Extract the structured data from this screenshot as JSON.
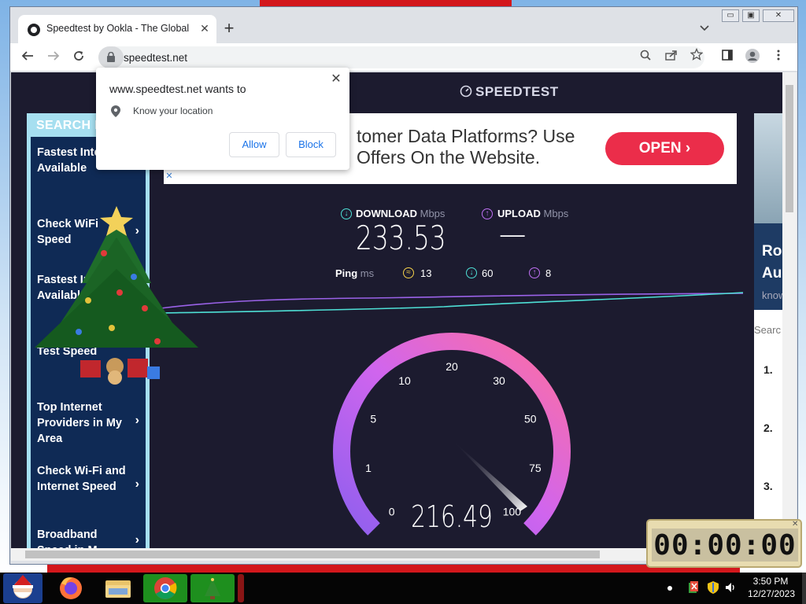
{
  "browser": {
    "tab_title": "Speedtest by Ookla - The Global",
    "tab_close": "✕",
    "new_tab": "+",
    "url": "speedtest.net",
    "window_buttons": [
      "▭",
      "▣",
      "✕"
    ]
  },
  "page": {
    "brand": "SPEEDTEST",
    "left_ad": {
      "header": "SEARCH F",
      "items": [
        "Fastest Internet Available",
        "Check WiFi Speed",
        "Fastest Internet Available",
        "Test Speed",
        "Top Internet Providers in My Area",
        "Check Wi-Fi and Internet Speed",
        "Broadband Speed in M"
      ],
      "chevron": "›"
    },
    "banner_ad": {
      "line1": "tomer Data Platforms? Use",
      "line2": "Offers On the Website.",
      "button": "OPEN",
      "close": "✕"
    },
    "right_ad": {
      "title_line1": "Ro",
      "title_line2": "Au",
      "know": "know",
      "search": "Searc",
      "numbers": [
        "1.",
        "2.",
        "3."
      ]
    },
    "results": {
      "download_label": "DOWNLOAD",
      "download_unit": "Mbps",
      "download_value": "233.53",
      "upload_label": "UPLOAD",
      "upload_unit": "Mbps",
      "upload_value": "—",
      "ping_label": "Ping",
      "ping_unit": "ms",
      "ping_idle": "13",
      "ping_download": "60",
      "ping_upload": "8"
    },
    "gauge": {
      "ticks": [
        "0",
        "1",
        "5",
        "10",
        "20",
        "30",
        "50",
        "75",
        "100"
      ],
      "current_value": "216.49",
      "fill_fraction": 1.0,
      "colors": {
        "start": "#9b6cf2",
        "end": "#ff6fa0",
        "track": "#25243a"
      }
    }
  },
  "permission_popup": {
    "title": "www.speedtest.net wants to",
    "permission": "Know your location",
    "allow": "Allow",
    "block": "Block",
    "close": "✕"
  },
  "clock_widget": {
    "time": "00:00:00"
  },
  "taskbar": {
    "time": "3:50 PM",
    "date": "12/27/2023"
  },
  "colors": {
    "page_bg": "#1c1b2f",
    "download_accent": "#4ee0d6",
    "upload_accent": "#bf70f3",
    "banner_button": "#eb2d4a"
  }
}
